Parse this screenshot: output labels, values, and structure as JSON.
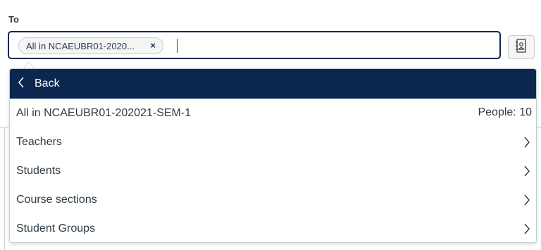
{
  "recipient": {
    "to_label": "To",
    "chip_label": "All in NCAEUBR01-2020...",
    "chip_remove": "×",
    "input_value": ""
  },
  "dropdown": {
    "back_label": "Back",
    "context": {
      "label": "All in NCAEUBR01-202021-SEM-1",
      "people_count": "People: 10"
    },
    "items": [
      {
        "label": "Teachers"
      },
      {
        "label": "Students"
      },
      {
        "label": "Course sections"
      },
      {
        "label": "Student Groups"
      }
    ]
  },
  "icons": {
    "address_book": "address-book-icon",
    "back": "chevron-left-icon",
    "item": "chevron-right-icon"
  },
  "colors": {
    "brand_navy": "#0b274f",
    "text": "#2d3b45",
    "border": "#c7cdd1"
  }
}
